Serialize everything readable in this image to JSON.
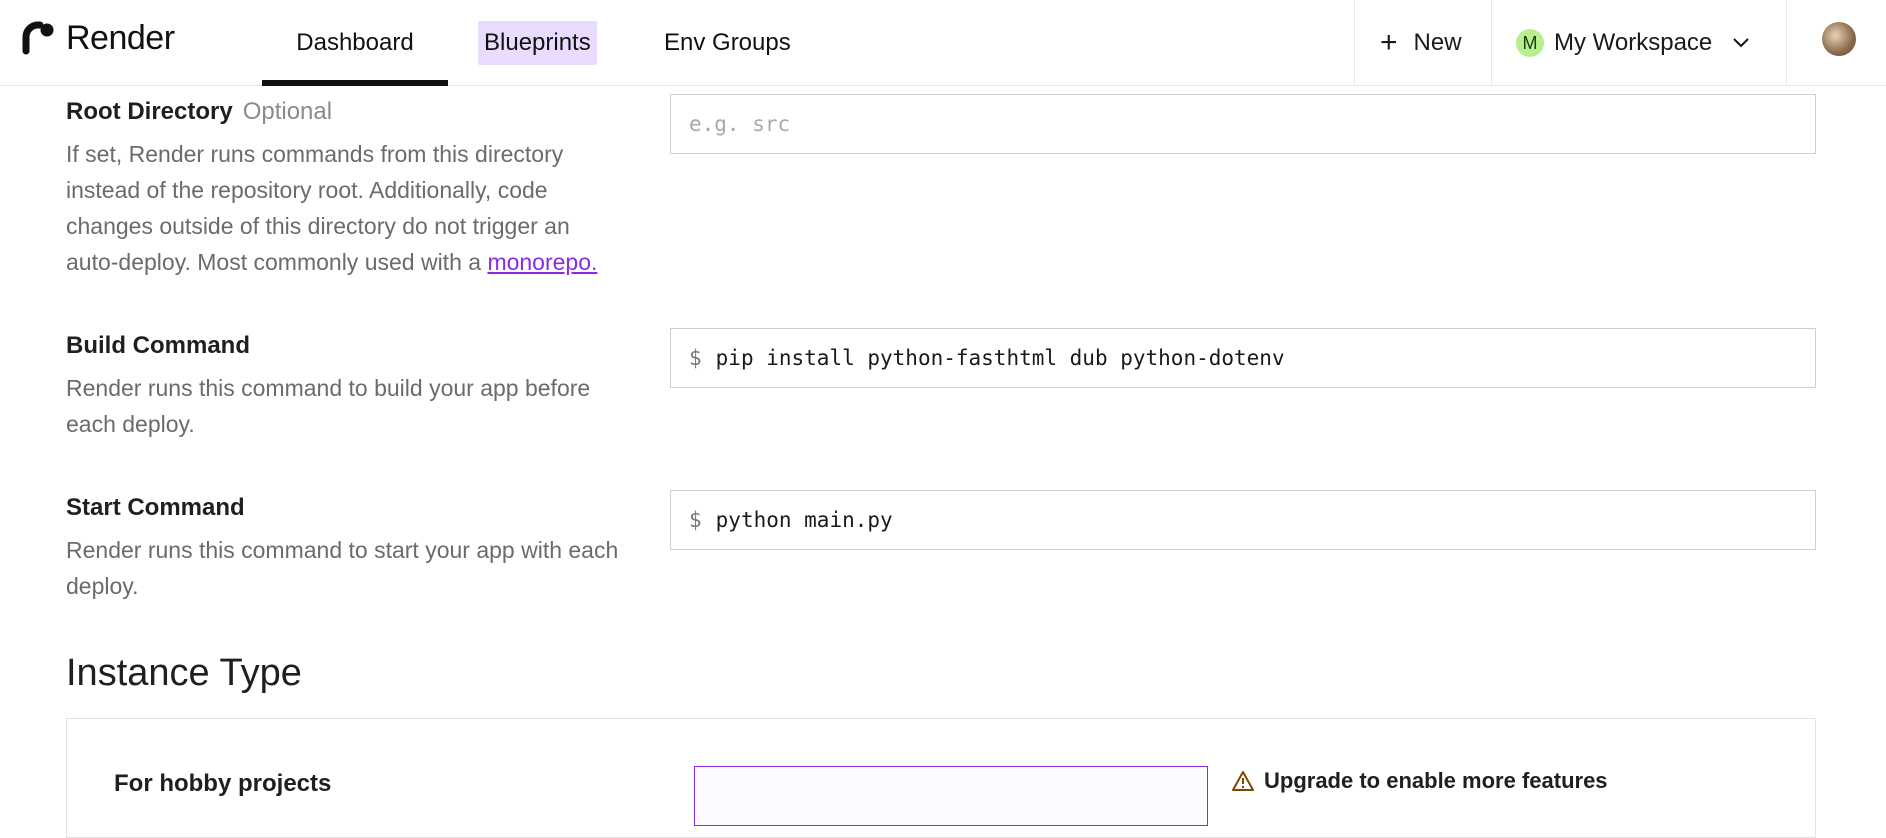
{
  "nav": {
    "brand": "Render",
    "tabs": [
      {
        "label": "Dashboard"
      },
      {
        "label": "Blueprints"
      },
      {
        "label": "Env Groups"
      }
    ],
    "new_label": "New",
    "workspace_initial": "M",
    "workspace_name": "My Workspace"
  },
  "form": {
    "root_directory": {
      "label": "Root Directory",
      "optional": "Optional",
      "description": "If set, Render runs commands from this directory instead of the repository root. Additionally, code changes outside of this directory do not trigger an auto-deploy. Most commonly used with a ",
      "link": "monorepo.",
      "placeholder": "e.g. src"
    },
    "build_command": {
      "label": "Build Command",
      "description": "Render runs this command to build your app before each deploy.",
      "prompt": "$",
      "value": "pip install python-fasthtml dub python-dotenv"
    },
    "start_command": {
      "label": "Start Command",
      "description": "Render runs this command to start your app with each deploy.",
      "prompt": "$",
      "value": "python main.py"
    }
  },
  "instance": {
    "title": "Instance Type",
    "hobby_label": "For hobby projects",
    "upgrade_label": "Upgrade to enable more features"
  },
  "colors": {
    "accent": "#8a2be2",
    "highlight": "#e9dcff",
    "workspace_badge": "#b7ef8e"
  }
}
